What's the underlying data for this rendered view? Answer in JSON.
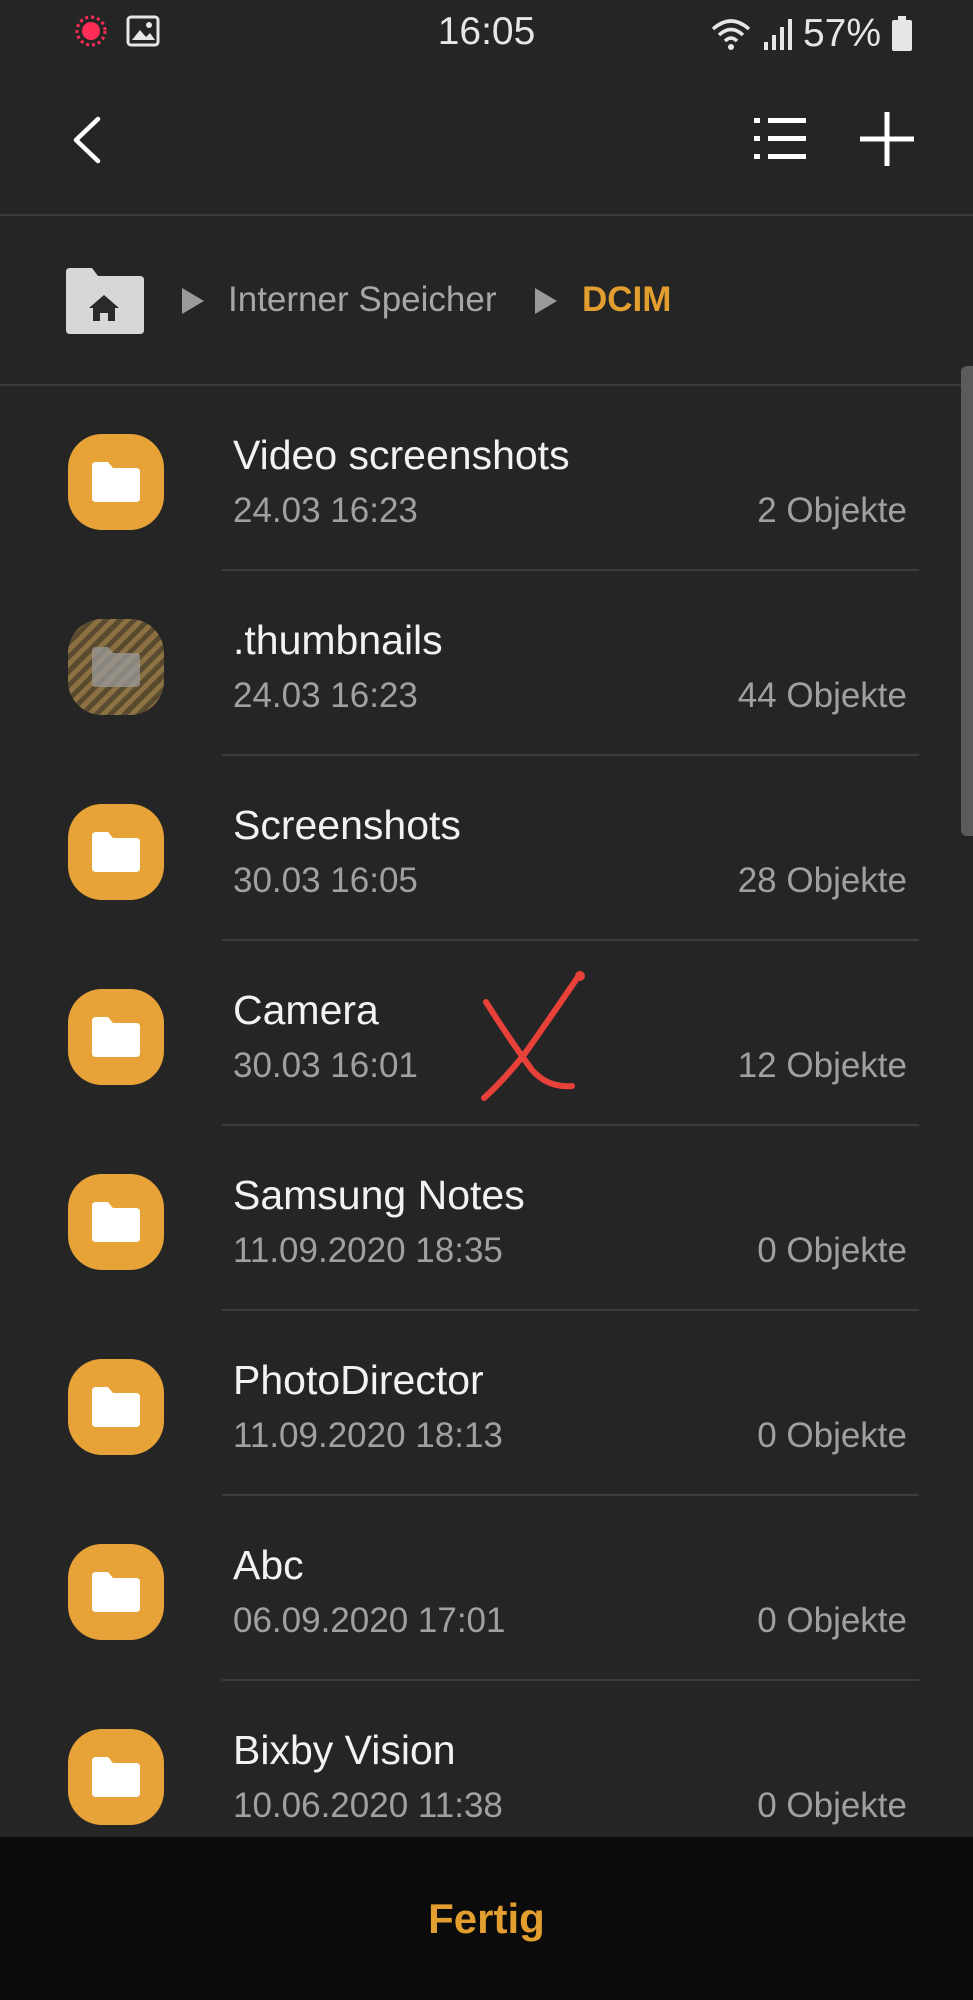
{
  "status_bar": {
    "time": "16:05",
    "battery": "57%",
    "icons": [
      "recording-icon",
      "gallery-icon",
      "wifi-icon",
      "signal-icon",
      "battery-icon"
    ]
  },
  "app_bar": {
    "icons": [
      "back-icon",
      "list-view-icon",
      "add-icon"
    ]
  },
  "breadcrumb": {
    "items": [
      "Interner Speicher",
      "DCIM"
    ],
    "home_icon": "home-icon"
  },
  "colors": {
    "accent": "#e29e2e",
    "folder": "#e7a338",
    "background": "#252525",
    "annotation": "#e8413a"
  },
  "folders": [
    {
      "name": "Video screenshots",
      "date": "24.03 16:23",
      "count": "2 Objekte"
    },
    {
      "name": ".thumbnails",
      "date": "24.03 16:23",
      "count": "44 Objekte"
    },
    {
      "name": "Screenshots",
      "date": "30.03 16:05",
      "count": "28 Objekte"
    },
    {
      "name": "Camera",
      "date": "30.03 16:01",
      "count": "12 Objekte"
    },
    {
      "name": "Samsung Notes",
      "date": "11.09.2020 18:35",
      "count": "0 Objekte"
    },
    {
      "name": "PhotoDirector",
      "date": "11.09.2020 18:13",
      "count": "0 Objekte"
    },
    {
      "name": "Abc",
      "date": "06.09.2020 17:01",
      "count": "0 Objekte"
    },
    {
      "name": "Bixby Vision",
      "date": "10.06.2020 11:38",
      "count": "0 Objekte"
    }
  ],
  "bottom_bar": {
    "done_label": "Fertig"
  }
}
